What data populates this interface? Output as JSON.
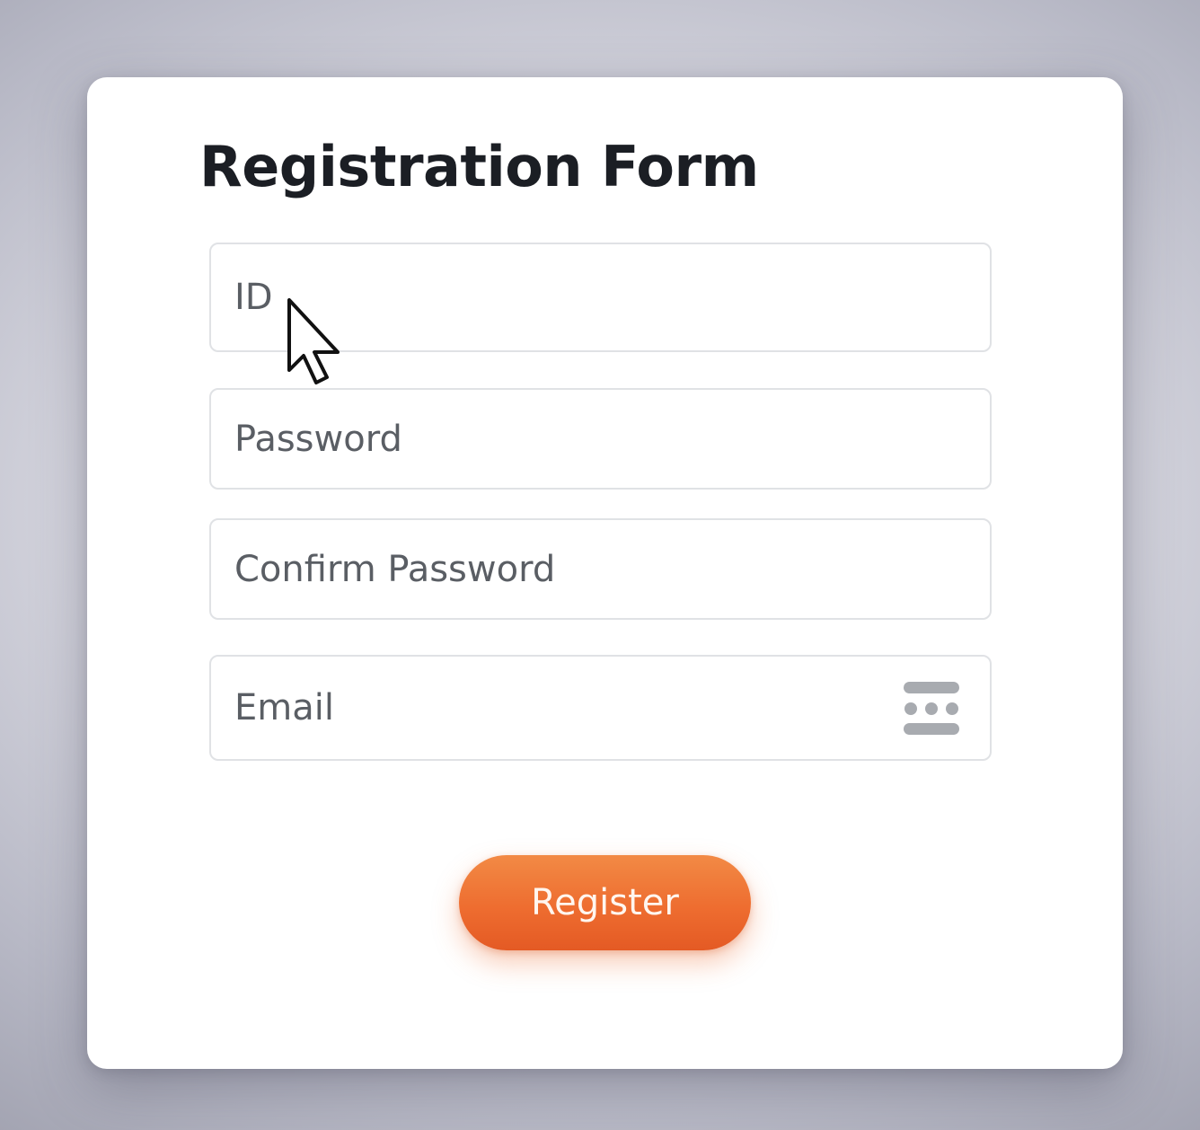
{
  "form": {
    "title": "Registration Form",
    "fields": [
      {
        "name": "id",
        "placeholder": "ID",
        "value": ""
      },
      {
        "name": "password",
        "placeholder": "Password",
        "value": ""
      },
      {
        "name": "confirm_password",
        "placeholder": "Confirm Password",
        "value": ""
      },
      {
        "name": "email",
        "placeholder": "Email",
        "value": ""
      }
    ],
    "email_icon": "autofill-dots-icon",
    "submit_label": "Register"
  },
  "pointer": {
    "icon": "mouse-pointer-icon"
  },
  "colors": {
    "accent": "#ee6d30",
    "title_text": "#1b1e24",
    "field_border": "#e0e2e5",
    "placeholder_text": "#5a5e64",
    "icon_gray": "#a8abb0"
  }
}
